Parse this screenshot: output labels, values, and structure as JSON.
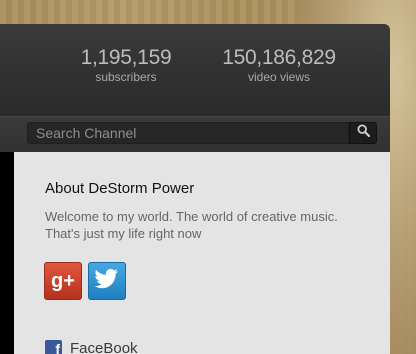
{
  "stats": {
    "subscribers_count": "1,195,159",
    "subscribers_label": "subscribers",
    "views_count": "150,186,829",
    "views_label": "video views"
  },
  "search": {
    "placeholder": "Search Channel"
  },
  "about": {
    "title": "About DeStorm Power",
    "description": "Welcome to my world. The world of creative music. That's just my life right now"
  },
  "social": {
    "gplus_text": "g+",
    "facebook_label": "FaceBook"
  },
  "colors": {
    "header_bg": "#2f2f2f",
    "panel_bg": "#e4e4e4",
    "gplus": "#d14836",
    "twitter": "#2d95d8",
    "facebook": "#3b5998"
  },
  "icons": [
    "search-icon",
    "google-plus-icon",
    "twitter-bird-icon",
    "facebook-icon"
  ]
}
